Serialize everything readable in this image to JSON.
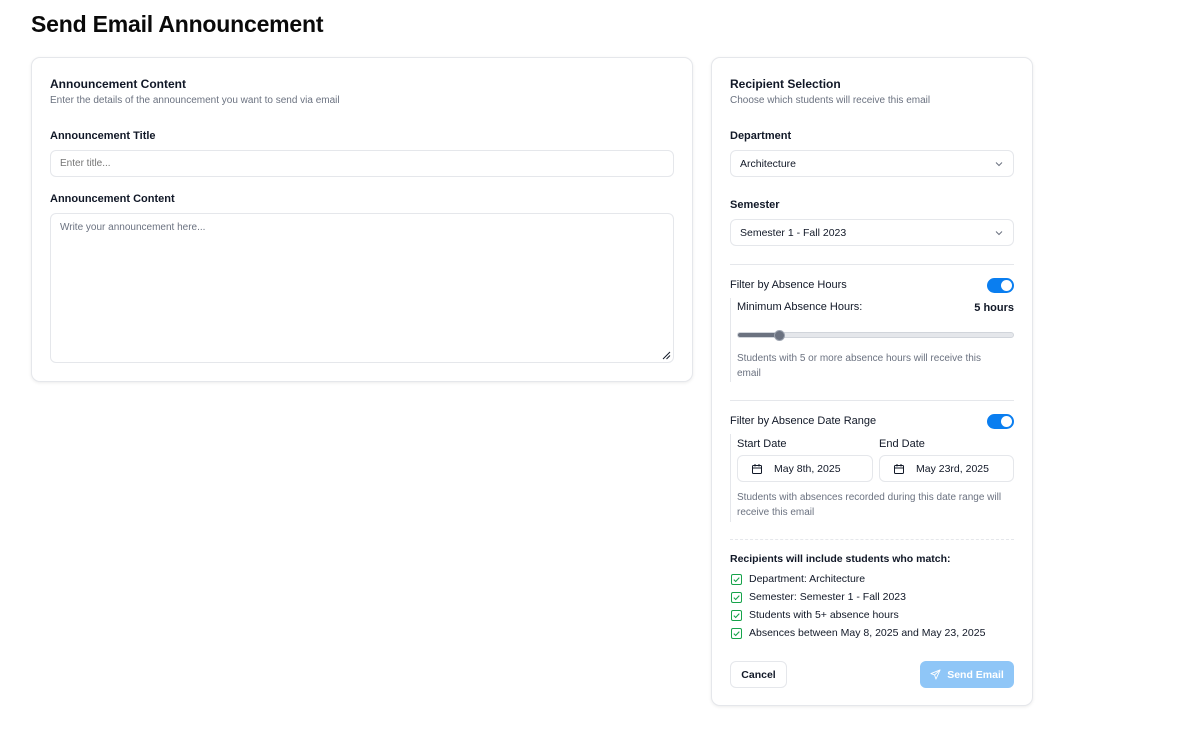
{
  "page": {
    "title": "Send Email Announcement"
  },
  "content_card": {
    "title": "Announcement Content",
    "description": "Enter the details of the announcement you want to send via email",
    "title_label": "Announcement Title",
    "title_value": "",
    "title_placeholder": "Enter title...",
    "content_label": "Announcement Content",
    "content_value": "",
    "content_placeholder": "Write your announcement here..."
  },
  "recipient_card": {
    "title": "Recipient Selection",
    "description": "Choose which students will receive this email",
    "department": {
      "label": "Department",
      "value": "Architecture"
    },
    "semester": {
      "label": "Semester",
      "value": "Semester 1 - Fall 2023"
    },
    "absence_hours": {
      "label": "Filter by Absence Hours",
      "enabled": true,
      "min_label": "Minimum Absence Hours:",
      "value_text": "5 hours",
      "slider_fraction": 0.15,
      "hint": "Students with 5 or more absence hours will receive this email"
    },
    "date_range": {
      "label": "Filter by Absence Date Range",
      "enabled": true,
      "start_label": "Start Date",
      "start_value": "May 8th, 2025",
      "end_label": "End Date",
      "end_value": "May 23rd, 2025",
      "hint": "Students with absences recorded during this date range will receive this email"
    },
    "summary": {
      "title": "Recipients will include students who match:",
      "items": [
        "Department: Architecture",
        "Semester: Semester 1 - Fall 2023",
        "Students with 5+ absence hours",
        "Absences between May 8, 2025 and May 23, 2025"
      ]
    },
    "cancel_label": "Cancel",
    "send_label": "Send Email"
  },
  "colors": {
    "accent": "#0a7ef0",
    "send_disabled": "#8fc6f7",
    "check_green": "#16a34a",
    "border": "#e5e7eb",
    "muted_text": "#6b7280"
  },
  "icons": {
    "select_chevron": "chevron-down-icon",
    "date": "calendar-icon",
    "summary_item": "check-square-icon",
    "send": "send-icon",
    "textarea_resize": "resize-handle-icon"
  }
}
